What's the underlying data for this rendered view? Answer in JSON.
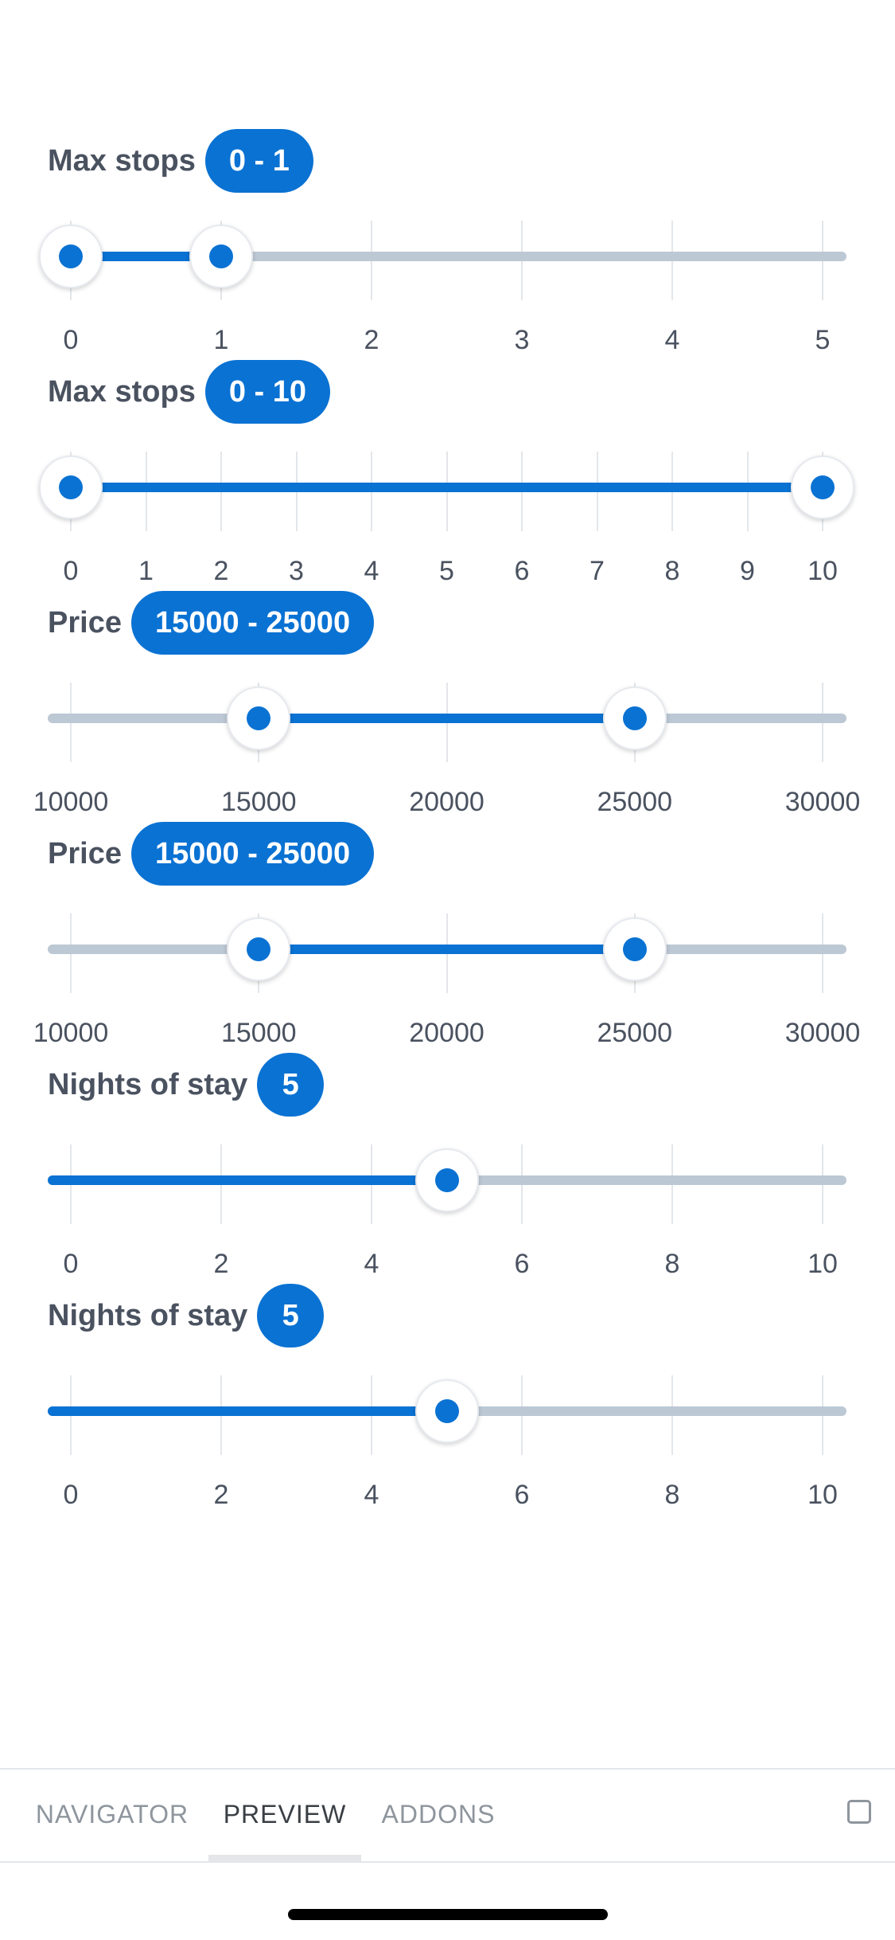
{
  "sliders": [
    {
      "title": "Max stops",
      "badge": "0 - 1",
      "min": 0,
      "max": 5,
      "step": 1,
      "ticks": [
        0,
        1,
        2,
        3,
        4,
        5
      ],
      "labels": [
        "0",
        "1",
        "2",
        "3",
        "4",
        "5"
      ],
      "values": [
        0,
        1
      ]
    },
    {
      "title": "Max stops",
      "badge": "0 - 10",
      "min": 0,
      "max": 10,
      "step": 1,
      "ticks": [
        0,
        1,
        2,
        3,
        4,
        5,
        6,
        7,
        8,
        9,
        10
      ],
      "labels": [
        "0",
        "1",
        "2",
        "3",
        "4",
        "5",
        "6",
        "7",
        "8",
        "9",
        "10"
      ],
      "values": [
        0,
        10
      ]
    },
    {
      "title": "Price",
      "badge": "15000 - 25000",
      "min": 10000,
      "max": 30000,
      "step": 5000,
      "ticks": [
        10000,
        15000,
        20000,
        25000,
        30000
      ],
      "labels": [
        "10000",
        "15000",
        "20000",
        "25000",
        "30000"
      ],
      "values": [
        15000,
        25000
      ]
    },
    {
      "title": "Price",
      "badge": "15000 - 25000",
      "min": 10000,
      "max": 30000,
      "step": 5000,
      "ticks": [
        10000,
        15000,
        20000,
        25000,
        30000
      ],
      "labels": [
        "10000",
        "15000",
        "20000",
        "25000",
        "30000"
      ],
      "values": [
        15000,
        25000
      ]
    },
    {
      "title": "Nights of stay",
      "badge": "5",
      "min": 0,
      "max": 10,
      "step": 2,
      "ticks": [
        0,
        2,
        4,
        6,
        8,
        10
      ],
      "labels": [
        "0",
        "2",
        "4",
        "6",
        "8",
        "10"
      ],
      "values": [
        5
      ]
    },
    {
      "title": "Nights of stay",
      "badge": "5",
      "min": 0,
      "max": 10,
      "step": 2,
      "ticks": [
        0,
        2,
        4,
        6,
        8,
        10
      ],
      "labels": [
        "0",
        "2",
        "4",
        "6",
        "8",
        "10"
      ],
      "values": [
        5
      ]
    }
  ],
  "tabs": [
    {
      "label": "NAVIGATOR",
      "active": false
    },
    {
      "label": "PREVIEW",
      "active": true
    },
    {
      "label": "ADDONS",
      "active": false
    }
  ],
  "toggle_icon": "square-checkbox-icon",
  "colors": {
    "accent": "#0a72d3",
    "rail": "#bcc8d4",
    "text": "#4a5260"
  }
}
